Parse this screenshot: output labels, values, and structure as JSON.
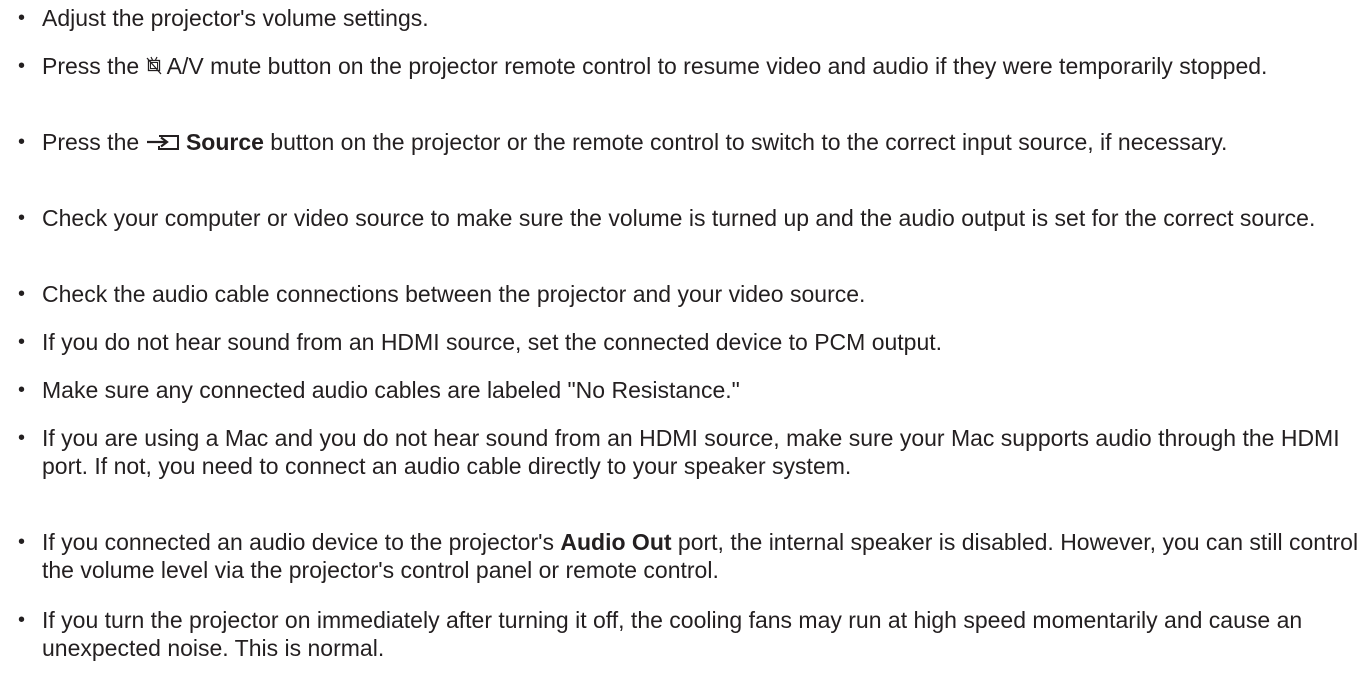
{
  "bullet_char": "•",
  "items": [
    {
      "parts": [
        "Adjust the projector's volume settings."
      ]
    },
    {
      "parts": [
        "Press the ",
        " A/V mute button on the projector remote control to resume video and audio if they were temporarily stopped."
      ],
      "icon": "av-mute-icon"
    },
    {
      "parts": [
        "Press the ",
        "Source",
        " button on the projector or the remote control to switch to the correct input source, if necessary."
      ],
      "icon": "source-icon"
    },
    {
      "parts": [
        "Check your computer or video source to make sure the volume is turned up and the audio output is set for the correct source."
      ]
    },
    {
      "parts": [
        "Check the audio cable connections between the projector and your video source."
      ]
    },
    {
      "parts": [
        "If you do not hear sound from an HDMI source, set the connected device to PCM output."
      ]
    },
    {
      "parts": [
        "Make sure any connected audio cables are labeled \"No Resistance.\""
      ]
    },
    {
      "parts": [
        "If you are using a Mac and you do not hear sound from an HDMI source, make sure your Mac supports audio through the HDMI port. If not, you need to connect an audio cable directly to your speaker system."
      ]
    },
    {
      "parts": [
        "If you connected an audio device to the projector's ",
        "Audio Out",
        " port, the internal speaker is disabled. However, you can still control the volume level via the projector's control panel or remote control."
      ]
    },
    {
      "parts": [
        "If you turn the projector on immediately after turning it off, the cooling fans may run at high speed momentarily and cause an unexpected noise. This is normal."
      ]
    }
  ]
}
